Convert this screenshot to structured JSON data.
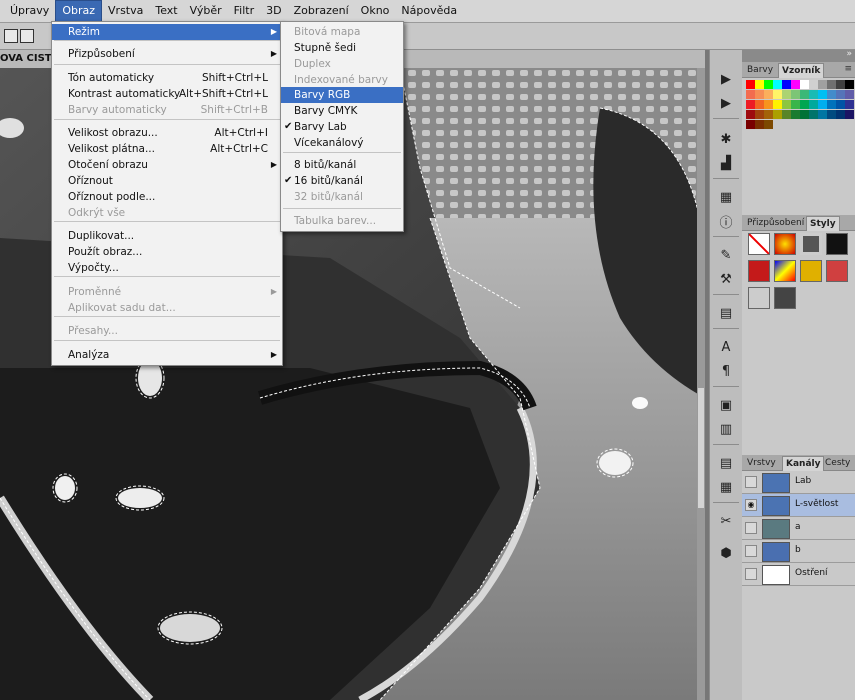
{
  "menubar": {
    "items": [
      "Úpravy",
      "Obraz",
      "Vrstva",
      "Text",
      "Výběr",
      "Filtr",
      "3D",
      "Zobrazení",
      "Okno",
      "Nápověda"
    ],
    "active": "Obraz"
  },
  "document": {
    "tab_title": "OVA CISTA Z"
  },
  "image_menu": {
    "items": [
      {
        "label": "Režim",
        "shortcut": "",
        "submenu": true,
        "disabled": false,
        "highlighted": true
      },
      {
        "label": "Přizpůsobení",
        "shortcut": "",
        "submenu": true,
        "disabled": false
      },
      {
        "label": "Tón automaticky",
        "shortcut": "Shift+Ctrl+L",
        "disabled": false
      },
      {
        "label": "Kontrast automaticky",
        "shortcut": "Alt+Shift+Ctrl+L",
        "disabled": false
      },
      {
        "label": "Barvy automaticky",
        "shortcut": "Shift+Ctrl+B",
        "disabled": true
      },
      {
        "label": "Velikost obrazu...",
        "shortcut": "Alt+Ctrl+I",
        "disabled": false
      },
      {
        "label": "Velikost plátna...",
        "shortcut": "Alt+Ctrl+C",
        "disabled": false
      },
      {
        "label": "Otočení obrazu",
        "shortcut": "",
        "submenu": true,
        "disabled": false
      },
      {
        "label": "Oříznout",
        "shortcut": "",
        "disabled": false
      },
      {
        "label": "Oříznout podle...",
        "shortcut": "",
        "disabled": false
      },
      {
        "label": "Odkrýt vše",
        "shortcut": "",
        "disabled": true
      },
      {
        "label": "Duplikovat...",
        "shortcut": "",
        "disabled": false
      },
      {
        "label": "Použít obraz...",
        "shortcut": "",
        "disabled": false
      },
      {
        "label": "Výpočty...",
        "shortcut": "",
        "disabled": false
      },
      {
        "label": "Proměnné",
        "shortcut": "",
        "submenu": true,
        "disabled": true
      },
      {
        "label": "Aplikovat sadu dat...",
        "shortcut": "",
        "disabled": true
      },
      {
        "label": "Přesahy...",
        "shortcut": "",
        "disabled": true
      },
      {
        "label": "Analýza",
        "shortcut": "",
        "submenu": true,
        "disabled": false
      }
    ]
  },
  "mode_submenu": {
    "items": [
      {
        "label": "Bitová mapa",
        "disabled": true,
        "checked": false
      },
      {
        "label": "Stupně šedi",
        "disabled": false,
        "checked": false
      },
      {
        "label": "Duplex",
        "disabled": true,
        "checked": false
      },
      {
        "label": "Indexované barvy",
        "disabled": true,
        "checked": false
      },
      {
        "label": "Barvy RGB",
        "disabled": false,
        "checked": false,
        "highlighted": true
      },
      {
        "label": "Barvy CMYK",
        "disabled": false,
        "checked": false
      },
      {
        "label": "Barvy Lab",
        "disabled": false,
        "checked": true
      },
      {
        "label": "Vícekanálový",
        "disabled": false,
        "checked": false
      },
      {
        "label": "8 bitů/kanál",
        "disabled": false,
        "checked": false
      },
      {
        "label": "16 bitů/kanál",
        "disabled": false,
        "checked": true
      },
      {
        "label": "32 bitů/kanál",
        "disabled": true,
        "checked": false
      },
      {
        "label": "Tabulka barev...",
        "disabled": true,
        "checked": false
      }
    ]
  },
  "panels": {
    "color_tabs": [
      "Barvy",
      "Vzorník"
    ],
    "adjust_tabs": [
      "Přizpůsobení",
      "Styly"
    ],
    "layer_tabs": [
      "Vrstvy",
      "Kanály",
      "Cesty"
    ],
    "channels": [
      {
        "name": "Lab",
        "visible": false,
        "selected": false
      },
      {
        "name": "L-světlost",
        "visible": true,
        "selected": true
      },
      {
        "name": "a",
        "visible": false,
        "selected": false
      },
      {
        "name": "b",
        "visible": false,
        "selected": false
      },
      {
        "name": "Ostření",
        "visible": false,
        "selected": false
      }
    ]
  },
  "colors": {
    "menu_highlight": "#3a6fc4",
    "selected_channel": "#a9bde0",
    "swatches": [
      "#ff0000",
      "#ffff00",
      "#00ff00",
      "#00ffff",
      "#0000ff",
      "#ff00ff",
      "#ffffff",
      "#d0d0d0",
      "#a0a0a0",
      "#707070",
      "#404040",
      "#000000",
      "#f26c4f",
      "#f68e55",
      "#fbaf5c",
      "#fff467",
      "#acd372",
      "#7cc576",
      "#3bb878",
      "#1abbb4",
      "#00bff3",
      "#438ccb",
      "#5574b9",
      "#605ca8",
      "#ed1c24",
      "#f26522",
      "#f7941d",
      "#fff200",
      "#8dc63f",
      "#39b54a",
      "#00a651",
      "#00a99d",
      "#00aeef",
      "#0072bc",
      "#0054a6",
      "#2e3192",
      "#9e0b0f",
      "#a0410d",
      "#a36209",
      "#aba000",
      "#598527",
      "#1a7b30",
      "#007236",
      "#00746b",
      "#0076a3",
      "#004b80",
      "#003471",
      "#1b1464",
      "#790000",
      "#7b2e00",
      "#7d4900"
    ]
  }
}
